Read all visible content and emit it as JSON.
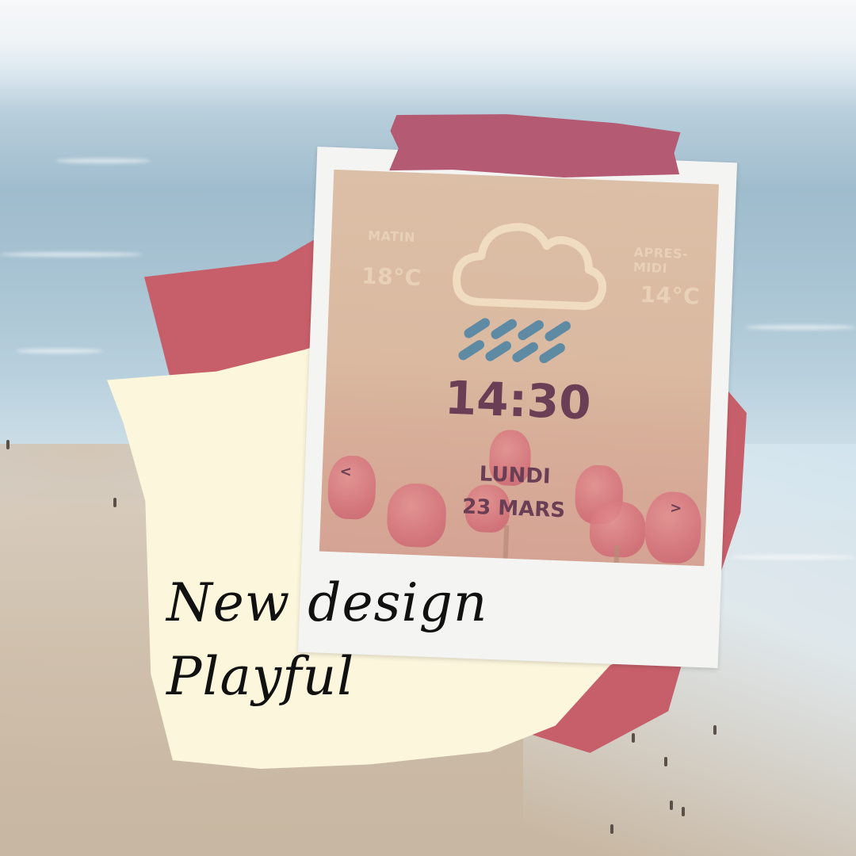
{
  "weather": {
    "morning_label": "MATIN",
    "morning_temp": "18°C",
    "afternoon_label": "APRES-MIDI",
    "afternoon_temp": "14°C",
    "icon": "cloud-rain-icon"
  },
  "clock": {
    "time": "14:30",
    "day": "LUNDI",
    "date": "23 MARS"
  },
  "nav": {
    "prev": "<",
    "next": ">"
  },
  "caption": {
    "line1": "New design",
    "line2": "Playful"
  },
  "colors": {
    "tape": "#b45a73",
    "red_paper": "#c75f6a",
    "cream_paper": "#fbf6dc",
    "rain": "#5e8aa3",
    "text_dark": "#6a3f55"
  }
}
